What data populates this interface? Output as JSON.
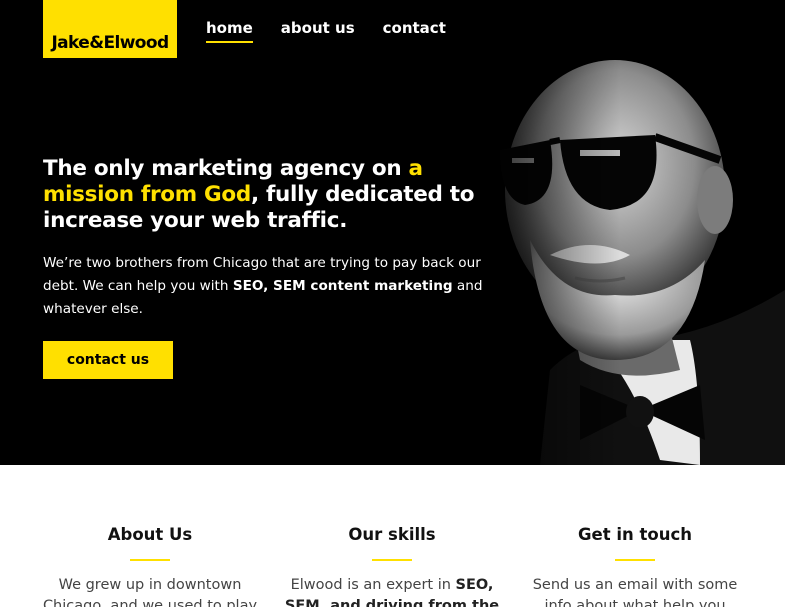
{
  "logo": {
    "text": "Jake&Elwood"
  },
  "nav": {
    "items": [
      {
        "label": "home",
        "active": true
      },
      {
        "label": "about us",
        "active": false
      },
      {
        "label": "contact",
        "active": false
      }
    ]
  },
  "hero": {
    "headline_part1": "The only marketing agency on ",
    "headline_highlight": "a mission from God",
    "headline_part2": ", fully dedicated to increase your web traffic.",
    "intro_part1": "We’re two brothers from Chicago that are trying to pay back our debt. We can help you with ",
    "intro_bold": "SEO, SEM content marketing",
    "intro_part2": " and whatever else.",
    "cta_label": "contact us",
    "photo_alt": "man-with-sunglasses-and-bowtie-photo"
  },
  "sections": [
    {
      "title": "About Us",
      "text": "We grew up in downtown Chicago, and we used to play"
    },
    {
      "title": "Our skills",
      "text_part1": "Elwood is an expert in ",
      "text_bold": "SEO, SEM, and driving from the"
    },
    {
      "title": "Get in touch",
      "text": "Send us an email with some info about what help you"
    }
  ],
  "colors": {
    "accent": "#ffe000",
    "hero_bg": "#000000",
    "text_dark": "#222222"
  }
}
